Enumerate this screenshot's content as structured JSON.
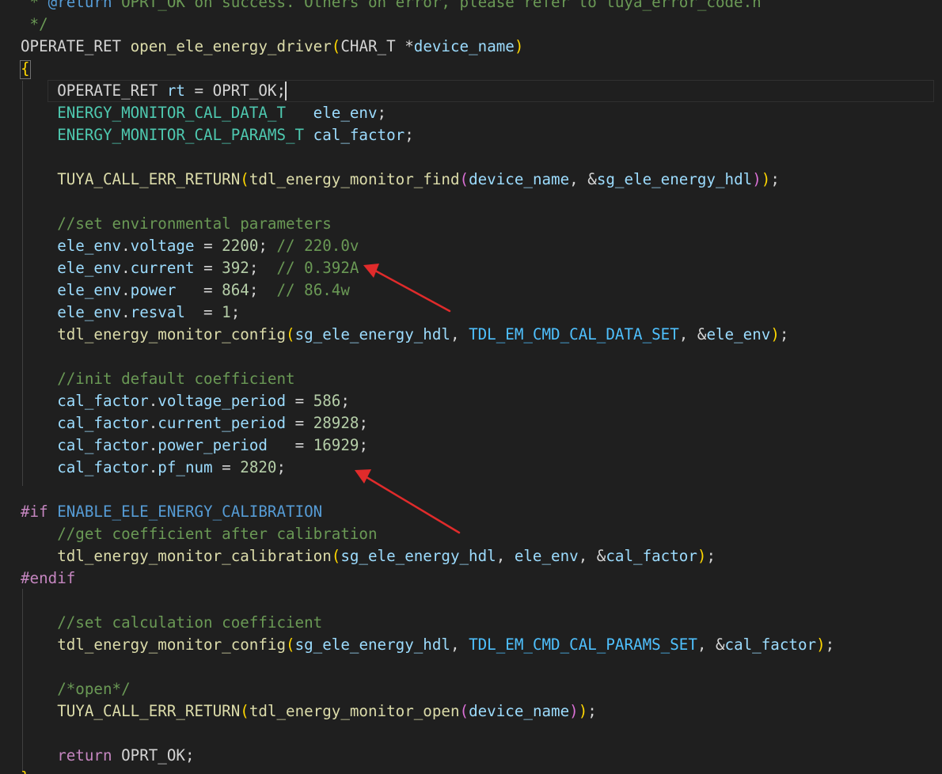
{
  "editor": {
    "theme": {
      "background": "#1f1f1f",
      "arrow_color": "#e02b2b"
    },
    "lines": [
      [
        {
          "t": " * ",
          "c": "doc"
        },
        {
          "t": "@return",
          "c": "doctag"
        },
        {
          "t": " OPRT_OK on success. Others on error, please refer to tuya_error_code.h",
          "c": "doc"
        }
      ],
      [
        {
          "t": " */",
          "c": "doc"
        }
      ],
      [
        {
          "t": "OPERATE_RET ",
          "c": "type"
        },
        {
          "t": "open_ele_energy_driver",
          "c": "func"
        },
        {
          "t": "(",
          "c": "paren1"
        },
        {
          "t": "CHAR_T ",
          "c": "type"
        },
        {
          "t": "*",
          "c": "plain"
        },
        {
          "t": "device_name",
          "c": "param"
        },
        {
          "t": ")",
          "c": "paren1"
        }
      ],
      [
        {
          "t": "{",
          "c": "brace"
        }
      ],
      [
        {
          "t": "    OPERATE_RET ",
          "c": "type"
        },
        {
          "t": "rt",
          "c": "var"
        },
        {
          "t": " = ",
          "c": "plain"
        },
        {
          "t": "OPRT_OK",
          "c": "type"
        },
        {
          "t": ";",
          "c": "plain"
        }
      ],
      [
        {
          "t": "    ENERGY_MONITOR_CAL_DATA_T",
          "c": "macro"
        },
        {
          "t": "   ",
          "c": "plain"
        },
        {
          "t": "ele_env",
          "c": "var"
        },
        {
          "t": ";",
          "c": "plain"
        }
      ],
      [
        {
          "t": "    ENERGY_MONITOR_CAL_PARAMS_T",
          "c": "macro"
        },
        {
          "t": " ",
          "c": "plain"
        },
        {
          "t": "cal_factor",
          "c": "var"
        },
        {
          "t": ";",
          "c": "plain"
        }
      ],
      [],
      [
        {
          "t": "    TUYA_CALL_ERR_RETURN",
          "c": "func"
        },
        {
          "t": "(",
          "c": "paren1"
        },
        {
          "t": "tdl_energy_monitor_find",
          "c": "func"
        },
        {
          "t": "(",
          "c": "paren2"
        },
        {
          "t": "device_name",
          "c": "param"
        },
        {
          "t": ", &",
          "c": "plain"
        },
        {
          "t": "sg_ele_energy_hdl",
          "c": "var"
        },
        {
          "t": ")",
          "c": "paren2"
        },
        {
          "t": ")",
          "c": "paren1"
        },
        {
          "t": ";",
          "c": "plain"
        }
      ],
      [],
      [
        {
          "t": "    //set environmental parameters",
          "c": "comment"
        }
      ],
      [
        {
          "t": "    ele_env",
          "c": "var"
        },
        {
          "t": ".",
          "c": "plain"
        },
        {
          "t": "voltage",
          "c": "var"
        },
        {
          "t": " = ",
          "c": "plain"
        },
        {
          "t": "2200",
          "c": "number"
        },
        {
          "t": "; ",
          "c": "plain"
        },
        {
          "t": "// 220.0v",
          "c": "comment"
        }
      ],
      [
        {
          "t": "    ele_env",
          "c": "var"
        },
        {
          "t": ".",
          "c": "plain"
        },
        {
          "t": "current",
          "c": "var"
        },
        {
          "t": " = ",
          "c": "plain"
        },
        {
          "t": "392",
          "c": "number"
        },
        {
          "t": ";  ",
          "c": "plain"
        },
        {
          "t": "// 0.392A",
          "c": "comment"
        }
      ],
      [
        {
          "t": "    ele_env",
          "c": "var"
        },
        {
          "t": ".",
          "c": "plain"
        },
        {
          "t": "power",
          "c": "var"
        },
        {
          "t": "   = ",
          "c": "plain"
        },
        {
          "t": "864",
          "c": "number"
        },
        {
          "t": ";  ",
          "c": "plain"
        },
        {
          "t": "// 86.4w",
          "c": "comment"
        }
      ],
      [
        {
          "t": "    ele_env",
          "c": "var"
        },
        {
          "t": ".",
          "c": "plain"
        },
        {
          "t": "resval",
          "c": "var"
        },
        {
          "t": "  = ",
          "c": "plain"
        },
        {
          "t": "1",
          "c": "number"
        },
        {
          "t": ";",
          "c": "plain"
        }
      ],
      [
        {
          "t": "    tdl_energy_monitor_config",
          "c": "func"
        },
        {
          "t": "(",
          "c": "paren1"
        },
        {
          "t": "sg_ele_energy_hdl",
          "c": "var"
        },
        {
          "t": ", ",
          "c": "plain"
        },
        {
          "t": "TDL_EM_CMD_CAL_DATA_SET",
          "c": "enum"
        },
        {
          "t": ", &",
          "c": "plain"
        },
        {
          "t": "ele_env",
          "c": "var"
        },
        {
          "t": ")",
          "c": "paren1"
        },
        {
          "t": ";",
          "c": "plain"
        }
      ],
      [],
      [
        {
          "t": "    //init default coefficient",
          "c": "comment"
        }
      ],
      [
        {
          "t": "    cal_factor",
          "c": "var"
        },
        {
          "t": ".",
          "c": "plain"
        },
        {
          "t": "voltage_period",
          "c": "var"
        },
        {
          "t": " = ",
          "c": "plain"
        },
        {
          "t": "586",
          "c": "number"
        },
        {
          "t": ";",
          "c": "plain"
        }
      ],
      [
        {
          "t": "    cal_factor",
          "c": "var"
        },
        {
          "t": ".",
          "c": "plain"
        },
        {
          "t": "current_period",
          "c": "var"
        },
        {
          "t": " = ",
          "c": "plain"
        },
        {
          "t": "28928",
          "c": "number"
        },
        {
          "t": ";",
          "c": "plain"
        }
      ],
      [
        {
          "t": "    cal_factor",
          "c": "var"
        },
        {
          "t": ".",
          "c": "plain"
        },
        {
          "t": "power_period",
          "c": "var"
        },
        {
          "t": "   = ",
          "c": "plain"
        },
        {
          "t": "16929",
          "c": "number"
        },
        {
          "t": ";",
          "c": "plain"
        }
      ],
      [
        {
          "t": "    cal_factor",
          "c": "var"
        },
        {
          "t": ".",
          "c": "plain"
        },
        {
          "t": "pf_num",
          "c": "var"
        },
        {
          "t": " = ",
          "c": "plain"
        },
        {
          "t": "2820",
          "c": "number"
        },
        {
          "t": ";",
          "c": "plain"
        }
      ],
      [],
      [
        {
          "t": "#if",
          "c": "keyword"
        },
        {
          "t": " ",
          "c": "plain"
        },
        {
          "t": "ENABLE_ELE_ENERGY_CALIBRATION",
          "c": "const"
        }
      ],
      [
        {
          "t": "    //get coefficient after calibration",
          "c": "comment"
        }
      ],
      [
        {
          "t": "    tdl_energy_monitor_calibration",
          "c": "func"
        },
        {
          "t": "(",
          "c": "paren1"
        },
        {
          "t": "sg_ele_energy_hdl",
          "c": "var"
        },
        {
          "t": ", ",
          "c": "plain"
        },
        {
          "t": "ele_env",
          "c": "var"
        },
        {
          "t": ", &",
          "c": "plain"
        },
        {
          "t": "cal_factor",
          "c": "var"
        },
        {
          "t": ")",
          "c": "paren1"
        },
        {
          "t": ";",
          "c": "plain"
        }
      ],
      [
        {
          "t": "#endif",
          "c": "keyword"
        }
      ],
      [],
      [
        {
          "t": "    //set calculation coefficient",
          "c": "comment"
        }
      ],
      [
        {
          "t": "    tdl_energy_monitor_config",
          "c": "func"
        },
        {
          "t": "(",
          "c": "paren1"
        },
        {
          "t": "sg_ele_energy_hdl",
          "c": "var"
        },
        {
          "t": ", ",
          "c": "plain"
        },
        {
          "t": "TDL_EM_CMD_CAL_PARAMS_SET",
          "c": "enum"
        },
        {
          "t": ", &",
          "c": "plain"
        },
        {
          "t": "cal_factor",
          "c": "var"
        },
        {
          "t": ")",
          "c": "paren1"
        },
        {
          "t": ";",
          "c": "plain"
        }
      ],
      [],
      [
        {
          "t": "    /*open*/",
          "c": "comment"
        }
      ],
      [
        {
          "t": "    TUYA_CALL_ERR_RETURN",
          "c": "func"
        },
        {
          "t": "(",
          "c": "paren1"
        },
        {
          "t": "tdl_energy_monitor_open",
          "c": "func"
        },
        {
          "t": "(",
          "c": "paren2"
        },
        {
          "t": "device_name",
          "c": "param"
        },
        {
          "t": ")",
          "c": "paren2"
        },
        {
          "t": ")",
          "c": "paren1"
        },
        {
          "t": ";",
          "c": "plain"
        }
      ],
      [],
      [
        {
          "t": "    return",
          "c": "keyword"
        },
        {
          "t": " ",
          "c": "plain"
        },
        {
          "t": "OPRT_OK",
          "c": "type"
        },
        {
          "t": ";",
          "c": "plain"
        }
      ],
      [
        {
          "t": "}",
          "c": "brace"
        }
      ]
    ]
  }
}
